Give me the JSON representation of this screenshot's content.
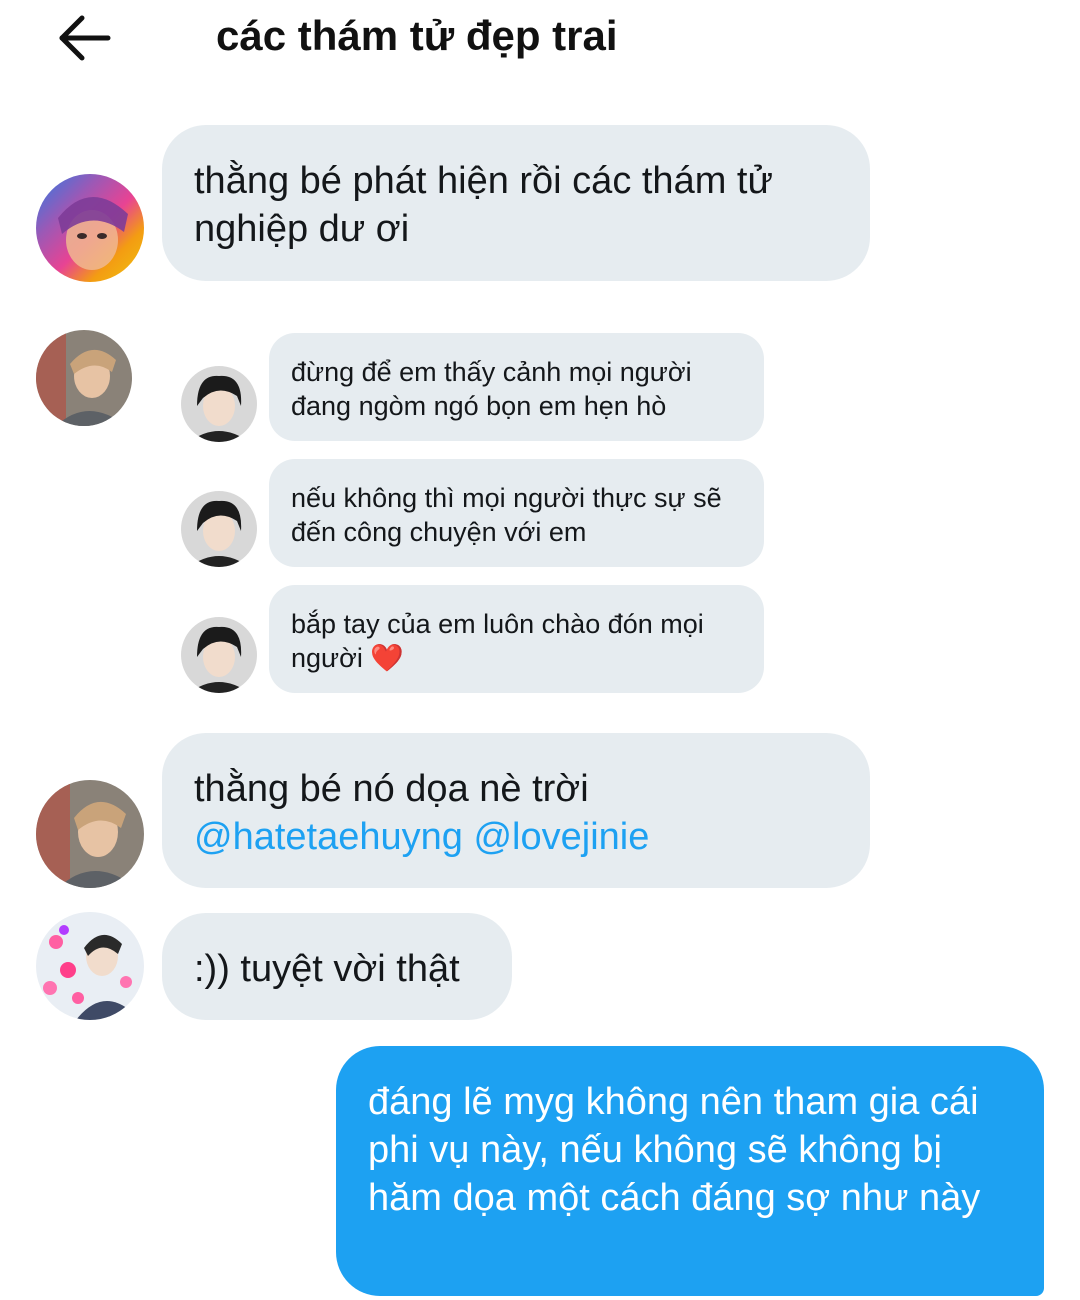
{
  "header": {
    "title": "các thám tử đẹp trai",
    "back_icon": "arrow-left-icon"
  },
  "messages": [
    {
      "text": "thằng bé phát hiện rồi các thám tử nghiệp dư ơi",
      "avatar_icon": "rainbow-portrait-avatar"
    },
    {
      "nested": [
        {
          "text": "đừng để em thấy cảnh mọi người đang ngòm ngó bọn em hẹn hò"
        },
        {
          "text": "nếu không thì mọi người thực sự sẽ đến công chuyện với em"
        },
        {
          "text": "bắp tay của em luôn chào đón mọi người",
          "emoji": "❤️"
        }
      ]
    },
    {
      "text": "thằng bé nó dọa nè trời",
      "mentions": [
        "@hatetaehuyng",
        "@lovejinie"
      ]
    },
    {
      "text": ":)) tuyệt vời thật"
    }
  ],
  "my_message": {
    "text": "đáng lẽ myg không nên tham gia cái phi vụ này, nếu không sẽ không bị hăm dọa một cách đáng sợ như này"
  },
  "colors": {
    "incoming_bubble": "#e6ecf0",
    "outgoing_bubble": "#1da1f2",
    "mention": "#1da1f2",
    "heart": "#dd2e44"
  }
}
